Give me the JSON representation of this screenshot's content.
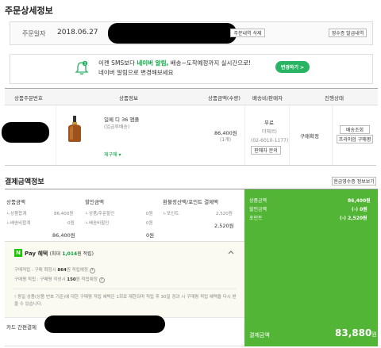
{
  "page_title": "주문상세정보",
  "order": {
    "date_label": "주문일자",
    "date_value": "2018.06.27",
    "order_detail_btn": "주문내역 삭제",
    "receipt_btn": "영수증 발급내역"
  },
  "notice": {
    "line1_prefix": "이젠 SMS보다",
    "line1_highlight": "네이버 알림,",
    "line1_suffix": "배송~도착예정까지 실시간으로!",
    "line2": "네이버 알림으로 변경해보세요",
    "change_btn": "변경하기 >"
  },
  "table": {
    "headers": [
      "상품주문번호",
      "상품정보",
      "상품금액(수량)",
      "배송비/판매자",
      "진행상태"
    ],
    "row": {
      "product_name": "일메 디 36 앰플",
      "product_option": "(입금후배송)",
      "repurchase": "재구매 ▾",
      "price": "86,400원",
      "qty": "(1개)",
      "shipping": "무료",
      "seller": "더해르)",
      "phone": "(02-6010-1177)",
      "seller_btn": "판매자 문의",
      "status": "구매확정",
      "track_btn": "배송조회",
      "premium_btn": "프리미엄 구매평"
    }
  },
  "payment": {
    "title": "결제금액정보",
    "cash_receipt_btn": "현금영수증 정보보기",
    "product_amount": {
      "label": "상품금액",
      "sub1_label": "ㄴ상품합계",
      "sub1_value": "86,400원",
      "sub2_label": "ㄴ배송비합계",
      "sub2_value": "0원",
      "total": "86,400원"
    },
    "discount": {
      "label": "할인금액",
      "sub1_label": "ㄴ상품/주문할인",
      "sub1_value": "0원",
      "sub2_label": "ㄴ배송비할인",
      "sub2_value": "0원",
      "total": "0원"
    },
    "refund": {
      "label": "환불정산액/포인트 결제액",
      "sub1_label": "ㄴ포인트",
      "sub1_value": "2,520원",
      "total": "2,520원"
    },
    "summary": {
      "rows": [
        {
          "label": "상품금액",
          "value": "86,400원"
        },
        {
          "label": "할인금액",
          "value": "(-) 0원"
        },
        {
          "label": "포인트",
          "value": "(-) 2,520원"
        }
      ],
      "final_label": "결제금액",
      "final_value": "83,880",
      "final_unit": "원"
    },
    "npay": {
      "logo": "N",
      "title_text": "Pay 혜택",
      "title_detail_prefix": "(최대",
      "title_detail_amount": "1,014",
      "title_detail_suffix": "원 적립)",
      "line1_prefix": "구매적립 : 구매 확정시",
      "line1_amount": "864",
      "line1_suffix": "원 적립예정",
      "line2_prefix": "구매평 적립 : 구매평 작성시",
      "line2_amount": "150",
      "line2_suffix": "원 적립예정",
      "warning": "! 동일 상품(상품 번호 기준)에 대한 구매평 적립 혜택은 1회로 제한되며 적립 후 30일 경과 시 구매평 적립 혜택을 다시 받을 수 있습니다."
    },
    "card_label": "카드 간편결제"
  }
}
